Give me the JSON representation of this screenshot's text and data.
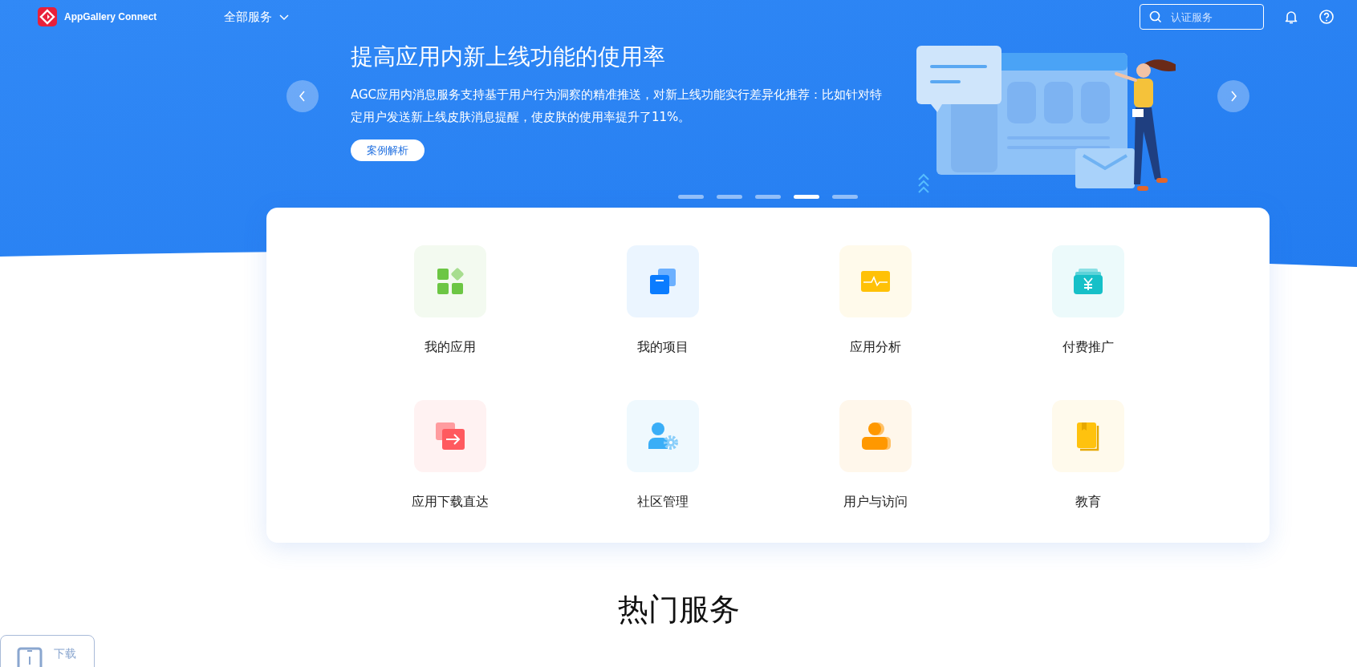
{
  "header": {
    "logo_text": "AppGallery Connect",
    "nav": "全部服务",
    "search": {
      "placeholder": "认证服务"
    }
  },
  "banner": {
    "title": "提高应用内新上线功能的使用率",
    "description": "AGC应用内消息服务支持基于用户行为洞察的精准推送，对新上线功能实行差异化推荐：比如针对特定用户发送新上线皮肤消息提醒，使皮肤的使用率提升了11%。",
    "button": "案例解析",
    "dots": [
      {
        "selected": false
      },
      {
        "selected": false
      },
      {
        "selected": false
      },
      {
        "selected": true
      },
      {
        "selected": false
      }
    ]
  },
  "services": [
    {
      "label": "我的应用",
      "kind": "apps",
      "color": "#6cc644"
    },
    {
      "label": "我的项目",
      "kind": "projects",
      "color": "#0a7cff"
    },
    {
      "label": "应用分析",
      "kind": "analytics",
      "color": "#ffc107"
    },
    {
      "label": "付费推广",
      "kind": "payment",
      "color": "#16c0c8"
    },
    {
      "label": "应用下载直达",
      "kind": "download",
      "color": "#ff5a5f"
    },
    {
      "label": "社区管理",
      "kind": "community",
      "color": "#3aaef7"
    },
    {
      "label": "用户与访问",
      "kind": "users",
      "color": "#ff9800"
    },
    {
      "label": "教育",
      "kind": "education",
      "color": "#ffc20e"
    }
  ],
  "section_title": "热门服务",
  "float_button": "下载"
}
